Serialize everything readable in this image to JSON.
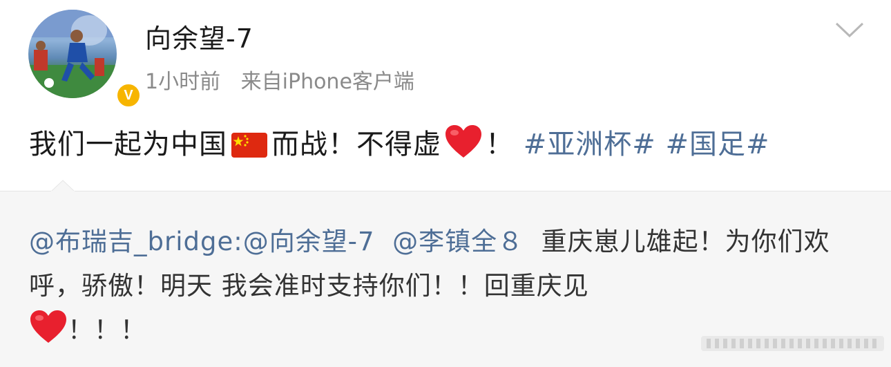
{
  "post": {
    "username": "向余望-7",
    "time": "1小时前",
    "source": "来自iPhone客户端",
    "text_part1": "我们一起为中国",
    "flag_icon": "china-flag-emoji",
    "text_part2": "而战！不得虚",
    "heart_icon": "red-heart-emoji",
    "text_part3": "！",
    "tags": [
      "#亚洲杯#",
      "#国足#"
    ],
    "verified_badge": "V"
  },
  "repost": {
    "mention1": "@布瑞吉_bridge:",
    "mention2": "@向余望-7",
    "mention3": "@李镇全８",
    "text1": "重庆崽儿雄起！为你们欢呼，骄傲！明天 我会准时支持你们！！回重庆见",
    "text2": "！！！"
  },
  "colors": {
    "link": "#4e6e96",
    "verified": "#f7b500",
    "repost_bg": "#f6f6f6"
  }
}
